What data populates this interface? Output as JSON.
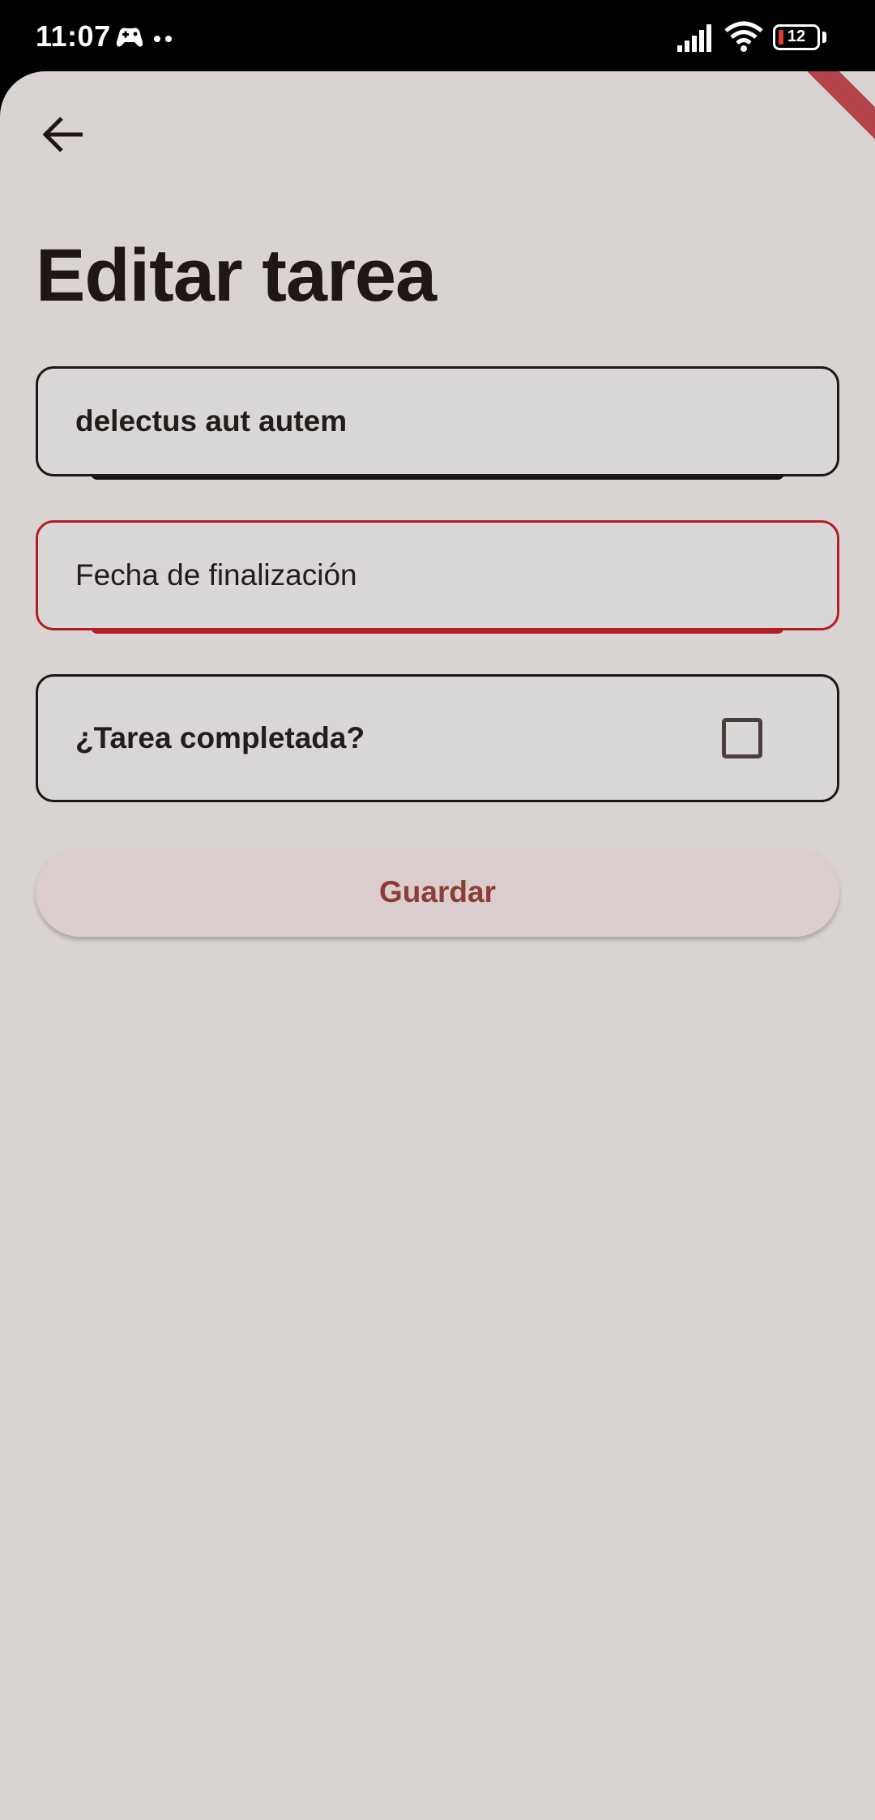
{
  "status_bar": {
    "time": "11:07",
    "app_icon": "game-controller-icon",
    "battery_level": "12",
    "colors": {
      "background": "#000000",
      "battery_low": "#e53935"
    }
  },
  "header": {
    "back_icon": "arrow-back-icon",
    "title": "Editar tarea"
  },
  "form": {
    "title_field": {
      "value": "delectus aut autem"
    },
    "date_field": {
      "placeholder": "Fecha de finalización",
      "value": ""
    },
    "completed": {
      "label": "¿Tarea completada?",
      "checked": false
    },
    "save_label": "Guardar"
  },
  "colors": {
    "background": "#d9d4d1",
    "field_fill": "#d8d6d6",
    "error_border": "#b41c26",
    "button_fill": "#dbcdcd",
    "button_text": "#8c3d36",
    "text": "#1e1716",
    "debug_banner": "#b3434a"
  }
}
